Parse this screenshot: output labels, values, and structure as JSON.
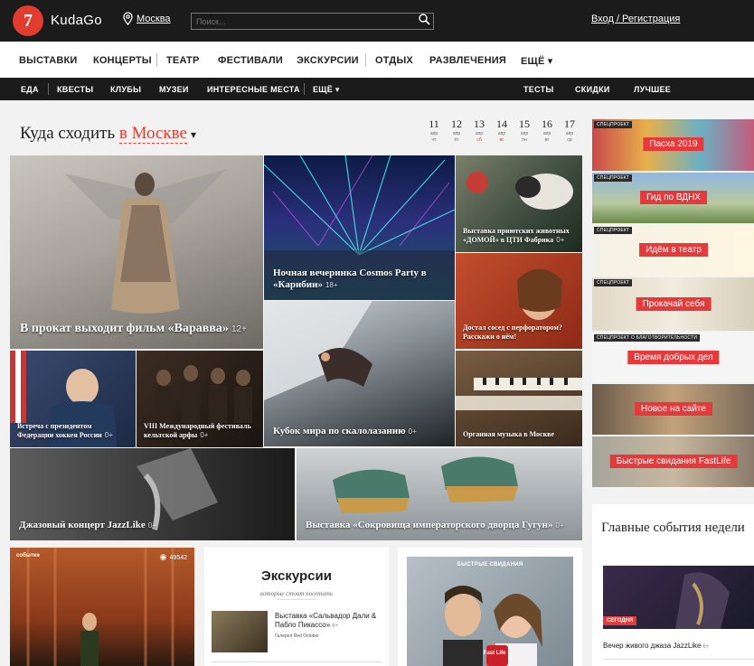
{
  "colors": {
    "accent": "#e23c2e",
    "dark": "#1b1b1b",
    "promo_red": "#e5393b"
  },
  "header": {
    "logo_glyph": "7",
    "logo_text": "KudaGo",
    "city": "Москва",
    "city_icon": "location-pin-icon",
    "search_placeholder": "Поиск...",
    "search_icon": "search-icon",
    "login": "Вход / Регистрация"
  },
  "main_nav": {
    "items": [
      "ВЫСТАВКИ",
      "КОНЦЕРТЫ",
      "ТЕАТР",
      "ФЕСТИВАЛИ",
      "ЭКСКУРСИИ",
      "ОТДЫХ",
      "РАЗВЛЕЧЕНИЯ",
      "ЕЩЁ ▾"
    ]
  },
  "sub_nav": {
    "items": [
      "ЕДА",
      "КВЕСТЫ",
      "КЛУБЫ",
      "МУЗЕИ",
      "ИНТЕРЕСНЫЕ МЕСТА",
      "ЕЩЁ ▾"
    ],
    "right_items": [
      "ТЕСТЫ",
      "СКИДКИ",
      "ЛУЧШЕЕ"
    ]
  },
  "heading": {
    "prefix": "Куда сходить",
    "city": "в Москве",
    "caret": "▾"
  },
  "dates": [
    {
      "day": "11",
      "month": "апр",
      "weekday": "чт",
      "weekend": false
    },
    {
      "day": "12",
      "month": "апр",
      "weekday": "пт",
      "weekend": false
    },
    {
      "day": "13",
      "month": "апр",
      "weekday": "сб",
      "weekend": true
    },
    {
      "day": "14",
      "month": "апр",
      "weekday": "вс",
      "weekend": true
    },
    {
      "day": "15",
      "month": "апр",
      "weekday": "пн",
      "weekend": false
    },
    {
      "day": "16",
      "month": "апр",
      "weekday": "вт",
      "weekend": false
    },
    {
      "day": "17",
      "month": "апр",
      "weekday": "ср",
      "weekend": false
    }
  ],
  "tiles": {
    "varavva": {
      "title": "В прокат выходит фильм «Варавва»",
      "age": "12+"
    },
    "cosmos": {
      "title": "Ночная вечеринка Cosmos Party в «Карибии»",
      "age": "18+"
    },
    "animals": {
      "title": "Выставка приютских животных «ДОМОЙ» в ЦТИ Фабрика",
      "age": "0+"
    },
    "neighbour": {
      "title": "Достал сосед с перфоратором? Расскажи о нём!",
      "age": ""
    },
    "climbing": {
      "title": "Кубок мира по скалолазанию",
      "age": "0+"
    },
    "hockey": {
      "title": "Встреча с президентом Федерации хоккея России",
      "age": "0+"
    },
    "harp": {
      "title": "VIII Международный фестиваль кельтской арфы",
      "age": "0+"
    },
    "organ": {
      "title": "Органная музыка в Москве",
      "age": ""
    },
    "jazz": {
      "title": "Джазовый концерт JazzLike",
      "age": "0+"
    },
    "gugun": {
      "title": "Выставка «Сокровища императорского дворца Гугун»",
      "age": "0+"
    }
  },
  "promos": [
    {
      "tag": "СПЕЦПРОЕКТ",
      "label": "Пасха 2019"
    },
    {
      "tag": "СПЕЦПРОЕКТ",
      "label": "Гид по ВДНХ"
    },
    {
      "tag": "СПЕЦПРОЕКТ",
      "label": "Идём в театр"
    },
    {
      "tag": "СПЕЦПРОЕКТ",
      "label": "Прокачай себя"
    },
    {
      "tag": "СПЕЦПРОЕКТ О БЛАГОТВОРИТЕЛЬНОСТИ",
      "label": "Время добрых дел"
    },
    {
      "tag": "",
      "label": "Новое на сайте"
    },
    {
      "tag": "",
      "label": "Быстрые свидания FastLife"
    }
  ],
  "bottom": {
    "event_card": {
      "tag": "событие",
      "views": "49542"
    },
    "excursions": {
      "title": "Экскурсии",
      "subtitle": "которые стоит посетить",
      "item_title": "Выставка «Сальвадор Дали & Пабло Пикассо»",
      "item_age": "6+",
      "item_place": "Галерея Red October"
    },
    "fast_dating": {
      "tag": "БЫСТРЫЕ СВИДАНИЯ",
      "badge": "Fast Life"
    },
    "main_week": {
      "title": "Главные события недели",
      "today": "СЕГОДНЯ",
      "event": "Вечер живого джаза JazzLike",
      "event_age": "6+"
    }
  }
}
